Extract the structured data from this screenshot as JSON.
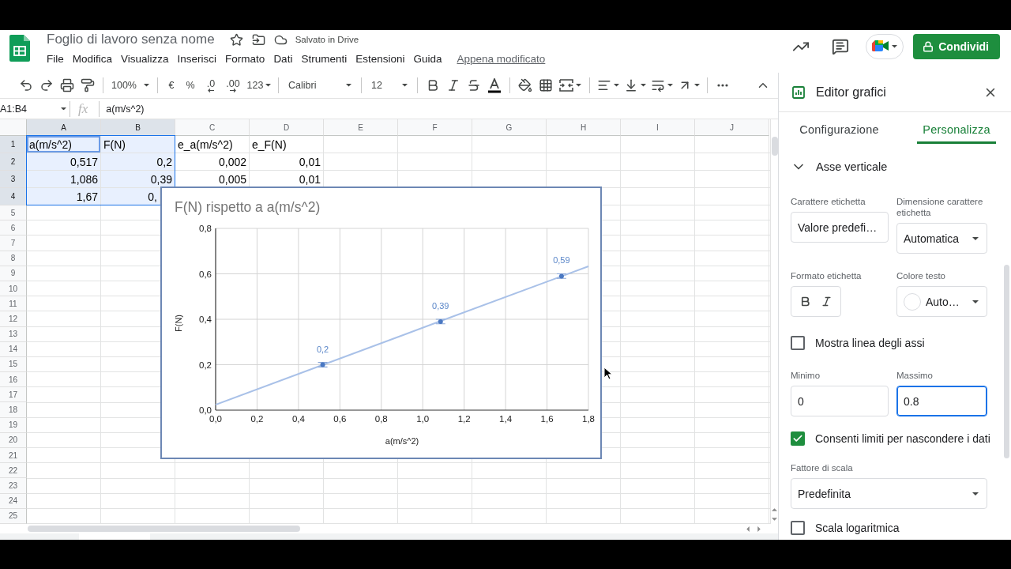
{
  "header": {
    "title": "Foglio di lavoro senza nome",
    "save_status": "Salvato in Drive",
    "menu": [
      "File",
      "Modifica",
      "Visualizza",
      "Inserisci",
      "Formato",
      "Dati",
      "Strumenti",
      "Estensioni",
      "Guida"
    ],
    "last_edit": "Appena modificato",
    "share_button": "Condividi"
  },
  "toolbar": {
    "zoom": "100%",
    "currency": "€",
    "percent": "%",
    "decrease_decimals": ".0",
    "increase_decimals": ".00",
    "more_formats": "123",
    "font": "Calibri",
    "font_size": "12"
  },
  "formula_bar": {
    "name_box": "A1:B4",
    "function_label": "fx",
    "formula": "a(m/s^2)"
  },
  "sheet": {
    "columns": [
      {
        "label": "A",
        "selected": true
      },
      {
        "label": "B",
        "selected": true
      },
      {
        "label": "C",
        "selected": false
      },
      {
        "label": "D",
        "selected": false
      },
      {
        "label": "E",
        "selected": false
      },
      {
        "label": "F",
        "selected": false
      },
      {
        "label": "G",
        "selected": false
      },
      {
        "label": "H",
        "selected": false
      },
      {
        "label": "I",
        "selected": false
      },
      {
        "label": "J",
        "selected": false
      }
    ],
    "rows": [
      {
        "label": "1",
        "selected": true,
        "cells": [
          {
            "text": "a(m/s^2)",
            "kind": "text",
            "selected": true,
            "active": true
          },
          {
            "text": "F(N)",
            "kind": "text",
            "selected": true,
            "active": false
          },
          {
            "text": "e_a(m/s^2)",
            "kind": "text",
            "selected": false,
            "active": false
          },
          {
            "text": "e_F(N)",
            "kind": "text",
            "selected": false,
            "active": false
          }
        ]
      },
      {
        "label": "2",
        "selected": true,
        "cells": [
          {
            "text": "0,517",
            "kind": "number",
            "selected": true,
            "active": false
          },
          {
            "text": "0,2",
            "kind": "number",
            "selected": true,
            "active": false
          },
          {
            "text": "0,002",
            "kind": "number",
            "selected": false,
            "active": false
          },
          {
            "text": "0,01",
            "kind": "number",
            "selected": false,
            "active": false
          }
        ]
      },
      {
        "label": "3",
        "selected": true,
        "cells": [
          {
            "text": "1,086",
            "kind": "number",
            "selected": true,
            "active": false
          },
          {
            "text": "0,39",
            "kind": "number",
            "selected": true,
            "active": false
          },
          {
            "text": "0,005",
            "kind": "number",
            "selected": false,
            "active": false
          },
          {
            "text": "0,01",
            "kind": "number",
            "selected": false,
            "active": false
          }
        ]
      },
      {
        "label": "4",
        "selected": true,
        "cells": [
          {
            "text": "1,67",
            "kind": "number",
            "selected": true,
            "active": false
          },
          {
            "text": "0,",
            "kind": "number",
            "selected": true,
            "active": false
          }
        ]
      },
      {
        "label": "5",
        "selected": false
      },
      {
        "label": "6",
        "selected": false
      },
      {
        "label": "7",
        "selected": false
      },
      {
        "label": "8",
        "selected": false
      },
      {
        "label": "9",
        "selected": false
      },
      {
        "label": "10",
        "selected": false
      },
      {
        "label": "11",
        "selected": false
      },
      {
        "label": "12",
        "selected": false
      },
      {
        "label": "13",
        "selected": false
      },
      {
        "label": "14",
        "selected": false
      },
      {
        "label": "15",
        "selected": false
      },
      {
        "label": "16",
        "selected": false
      },
      {
        "label": "17",
        "selected": false
      },
      {
        "label": "18",
        "selected": false
      },
      {
        "label": "19",
        "selected": false
      },
      {
        "label": "20",
        "selected": false
      },
      {
        "label": "21",
        "selected": false
      },
      {
        "label": "22",
        "selected": false
      },
      {
        "label": "23",
        "selected": false
      },
      {
        "label": "24",
        "selected": false
      },
      {
        "label": "25",
        "selected": false
      }
    ]
  },
  "chart": {
    "selected": true,
    "chart_data": {
      "type": "scatter",
      "title": "F(N) rispetto a a(m/s^2)",
      "xlabel": "a(m/s^2)",
      "ylabel": "F(N)",
      "x": [
        0,
        0.517,
        1.086,
        1.67,
        1.8
      ],
      "series": [
        {
          "color": "#4a78c2",
          "values": [
            null,
            0.2,
            0.39,
            0.59,
            null
          ],
          "errors": [
            null,
            0.01,
            0.01,
            0.01,
            null
          ]
        },
        {
          "type": "line",
          "color": "#a9c1e8",
          "values": [
            0.024,
            0.199,
            0.392,
            0.589,
            0.633
          ]
        }
      ],
      "xlim": [
        0,
        1.8
      ],
      "ylim": [
        0,
        0.8
      ],
      "grid": true,
      "xticks": [
        {
          "value": 0,
          "label": "0,0"
        },
        {
          "value": 0.2,
          "label": "0,2"
        },
        {
          "value": 0.4,
          "label": "0,4"
        },
        {
          "value": 0.6,
          "label": "0,6"
        },
        {
          "value": 0.8,
          "label": "0,8"
        },
        {
          "value": 1.0,
          "label": "1,0"
        },
        {
          "value": 1.2,
          "label": "1,2"
        },
        {
          "value": 1.4,
          "label": "1,4"
        },
        {
          "value": 1.6,
          "label": "1,6"
        },
        {
          "value": 1.8,
          "label": "1,8"
        }
      ],
      "yticks": [
        {
          "value": 0,
          "label": "0,0"
        },
        {
          "value": 0.2,
          "label": "0,2"
        },
        {
          "value": 0.4,
          "label": "0,4"
        },
        {
          "value": 0.6,
          "label": "0,6"
        },
        {
          "value": 0.8,
          "label": "0,8"
        }
      ],
      "value_labels": [
        null,
        "0,2",
        "0,39",
        "0,59",
        null
      ]
    }
  },
  "chart_editor": {
    "title": "Editor grafici",
    "tabs": [
      {
        "label": "Configurazione",
        "selected": false
      },
      {
        "label": "Personalizza",
        "selected": true
      }
    ],
    "section": {
      "label": "Asse verticale",
      "expanded": true
    },
    "rows": [
      [
        {
          "kind": "select",
          "label": "Carattere etichetta",
          "value": "Valore predefi…"
        },
        {
          "kind": "select",
          "label": "Dimensione carattere etichetta",
          "value": "Automatica"
        }
      ],
      [
        {
          "kind": "format_buttons",
          "label": "Formato etichetta"
        },
        {
          "kind": "color_select",
          "label": "Colore testo",
          "value": "Auto…"
        }
      ],
      [
        {
          "kind": "checkbox",
          "label": "Mostra linea degli assi",
          "checked": false
        }
      ],
      [
        {
          "kind": "input",
          "label": "Minimo",
          "value": "0",
          "focused": false
        },
        {
          "kind": "input",
          "label": "Massimo",
          "value": "0.8",
          "focused": true
        }
      ],
      [
        {
          "kind": "checkbox",
          "label": "Consenti limiti per nascondere i dati",
          "checked": true
        }
      ],
      [
        {
          "kind": "select",
          "label": "Fattore di scala",
          "value": "Predefinita"
        }
      ],
      [
        {
          "kind": "checkbox",
          "label": "Scala logaritmica",
          "checked": false
        }
      ]
    ]
  }
}
